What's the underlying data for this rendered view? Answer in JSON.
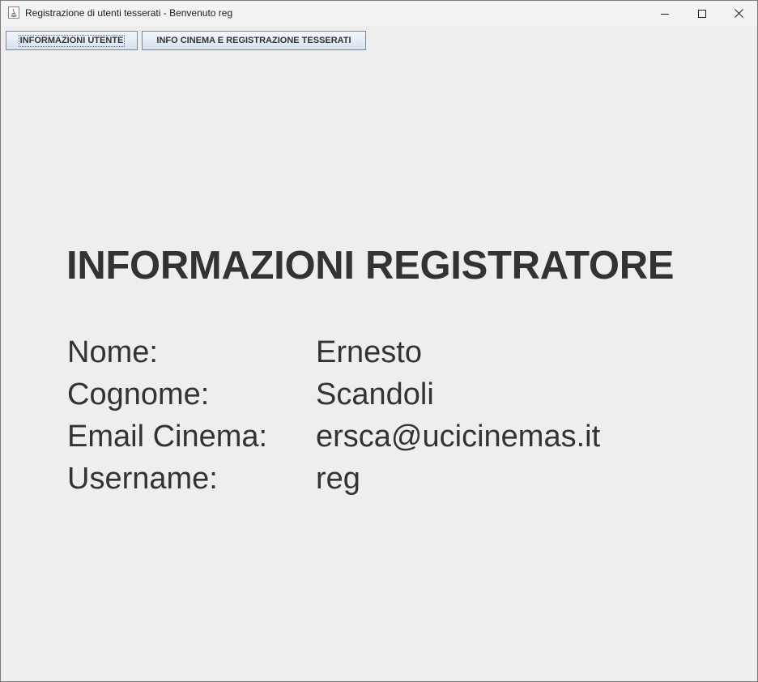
{
  "window": {
    "title": "Registrazione di utenti tesserati - Benvenuto reg",
    "app_icon": "java-icon"
  },
  "tabs": [
    {
      "label": "INFORMAZIONI UTENTE",
      "active": true
    },
    {
      "label": "INFO CINEMA E REGISTRAZIONE TESSERATI",
      "active": false
    }
  ],
  "main": {
    "heading": "INFORMAZIONI REGISTRATORE",
    "fields": [
      {
        "label": "Nome:",
        "value": "Ernesto"
      },
      {
        "label": "Cognome:",
        "value": "Scandoli"
      },
      {
        "label": "Email Cinema:",
        "value": "ersca@ucicinemas.it"
      },
      {
        "label": "Username:",
        "value": "reg"
      }
    ]
  },
  "colors": {
    "background": "#eeeeee",
    "text": "#333333",
    "titlebar": "#f3f3f3"
  }
}
